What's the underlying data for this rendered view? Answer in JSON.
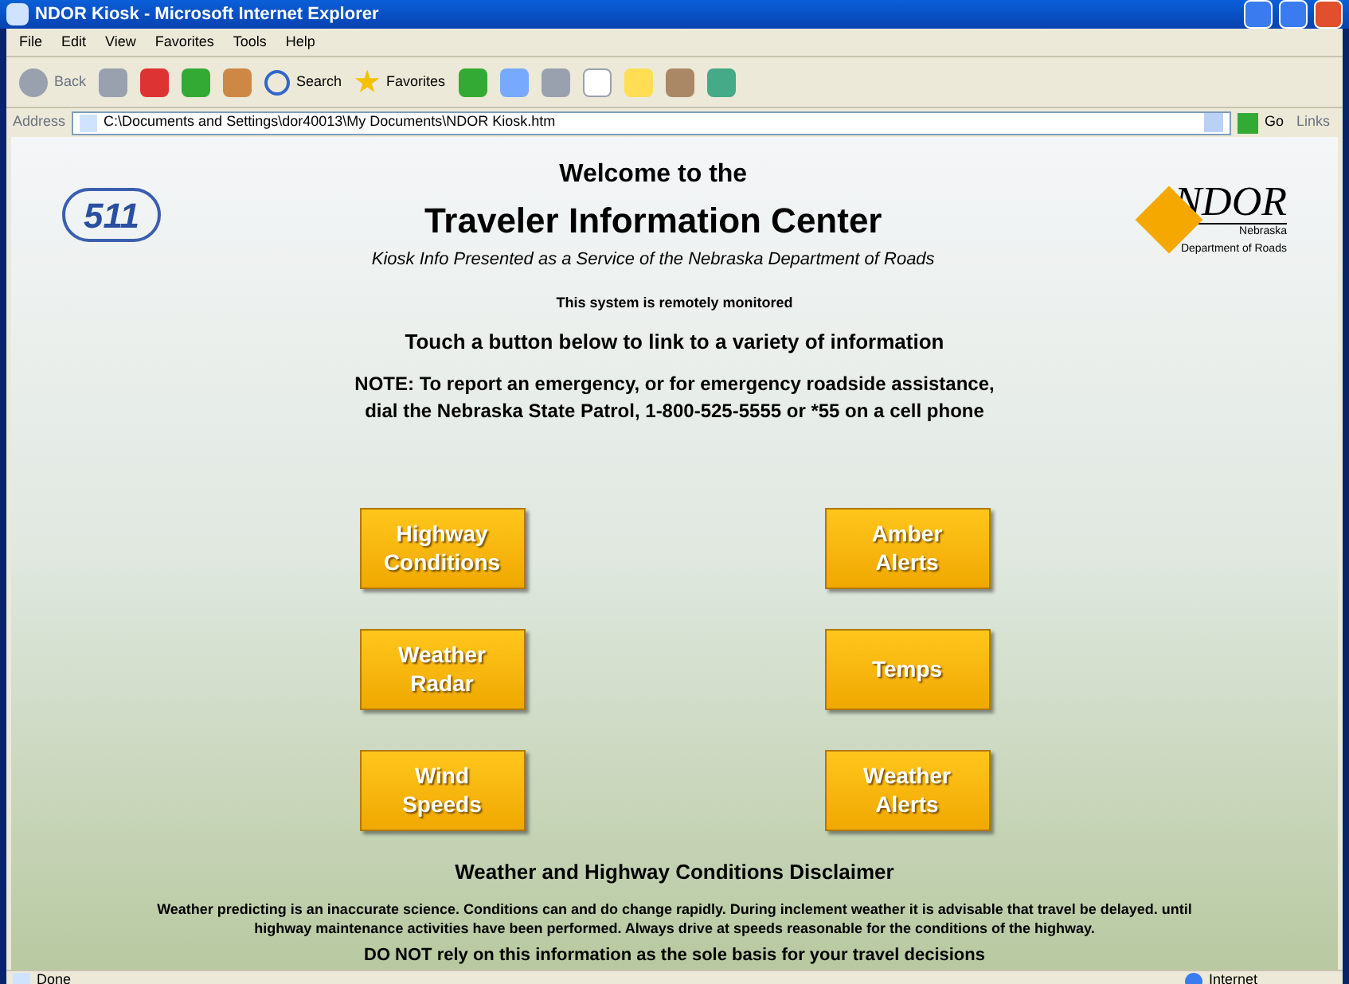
{
  "window": {
    "title": "NDOR Kiosk - Microsoft Internet Explorer"
  },
  "menu": [
    "File",
    "Edit",
    "View",
    "Favorites",
    "Tools",
    "Help"
  ],
  "toolbar": {
    "back": "Back",
    "search": "Search",
    "favorites": "Favorites"
  },
  "address": {
    "label": "Address",
    "url": "C:\\Documents and Settings\\dor40013\\My Documents\\NDOR Kiosk.htm",
    "go": "Go",
    "links": "Links"
  },
  "page": {
    "logo_511": "511",
    "ndor_logo": "NDOR",
    "ndor_sub": "Nebraska\nDepartment of Roads",
    "welcome": "Welcome to the",
    "title": "Traveler Information Center",
    "subtitle": "Kiosk Info Presented as a Service of the Nebraska Department of Roads",
    "monitored": "This system is remotely monitored",
    "touch": "Touch a button below to link to a variety of information",
    "note": [
      "NOTE: To report an emergency, or for emergency roadside assistance,",
      "dial the Nebraska State Patrol, 1-800-525-5555 or *55 on a cell phone"
    ],
    "buttons": [
      {
        "label": "Highway\nConditions"
      },
      {
        "label": "Amber\nAlerts"
      },
      {
        "label": "Weather\nRadar"
      },
      {
        "label": "Temps"
      },
      {
        "label": "Wind\nSpeeds"
      },
      {
        "label": "Weather\nAlerts"
      }
    ],
    "disclaimer_title": "Weather and Highway Conditions Disclaimer",
    "disclaimer": "Weather predicting is an inaccurate science. Conditions can and do change rapidly. During inclement weather it is advisable that travel be delayed. until highway maintenance activities have been performed. Always drive at speeds reasonable for the conditions of the highway.",
    "warning": "DO NOT rely on this information as the sole basis for your travel decisions"
  },
  "status_bar": {
    "text": "Done",
    "zone": "Internet"
  }
}
